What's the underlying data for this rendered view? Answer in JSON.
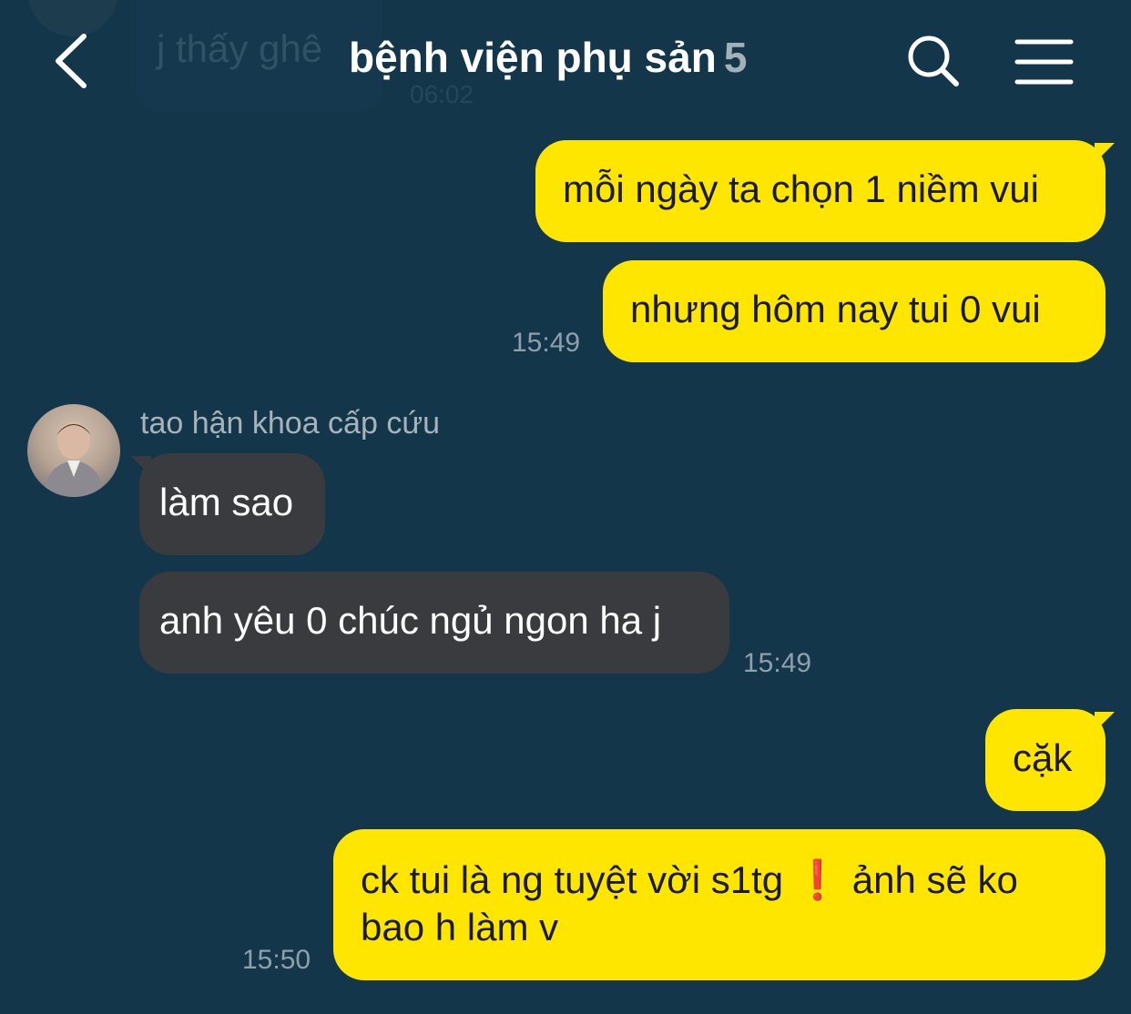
{
  "header": {
    "title": "bệnh viện phụ sản",
    "member_count": "5",
    "back_icon": "chevron-left-icon",
    "search_icon": "search-icon",
    "menu_icon": "menu-icon"
  },
  "ghost_message": {
    "text": "j thấy ghê",
    "time": "06:02"
  },
  "sender": {
    "name": "tao hận khoa cấp cứu"
  },
  "messages": [
    {
      "from": "me",
      "text": "mỗi ngày ta chọn 1 niềm vui"
    },
    {
      "from": "me",
      "text": "nhưng hôm nay tui 0 vui",
      "time": "15:49"
    },
    {
      "from": "them",
      "text": "làm sao"
    },
    {
      "from": "them",
      "text": "anh yêu 0 chúc ngủ ngon ha j",
      "time": "15:49"
    },
    {
      "from": "me",
      "text": "cặk"
    },
    {
      "from": "me",
      "text_a": "ck tui là ng tuyệt vời s1tg",
      "emoji": "❗",
      "text_b": "ảnh sẽ ko",
      "text_c": "bao h làm v",
      "time": "15:50"
    }
  ],
  "colors": {
    "background": "#14364b",
    "my_bubble": "#ffe600",
    "their_bubble": "#3a3b3e",
    "timestamp": "#8fa0ab"
  }
}
